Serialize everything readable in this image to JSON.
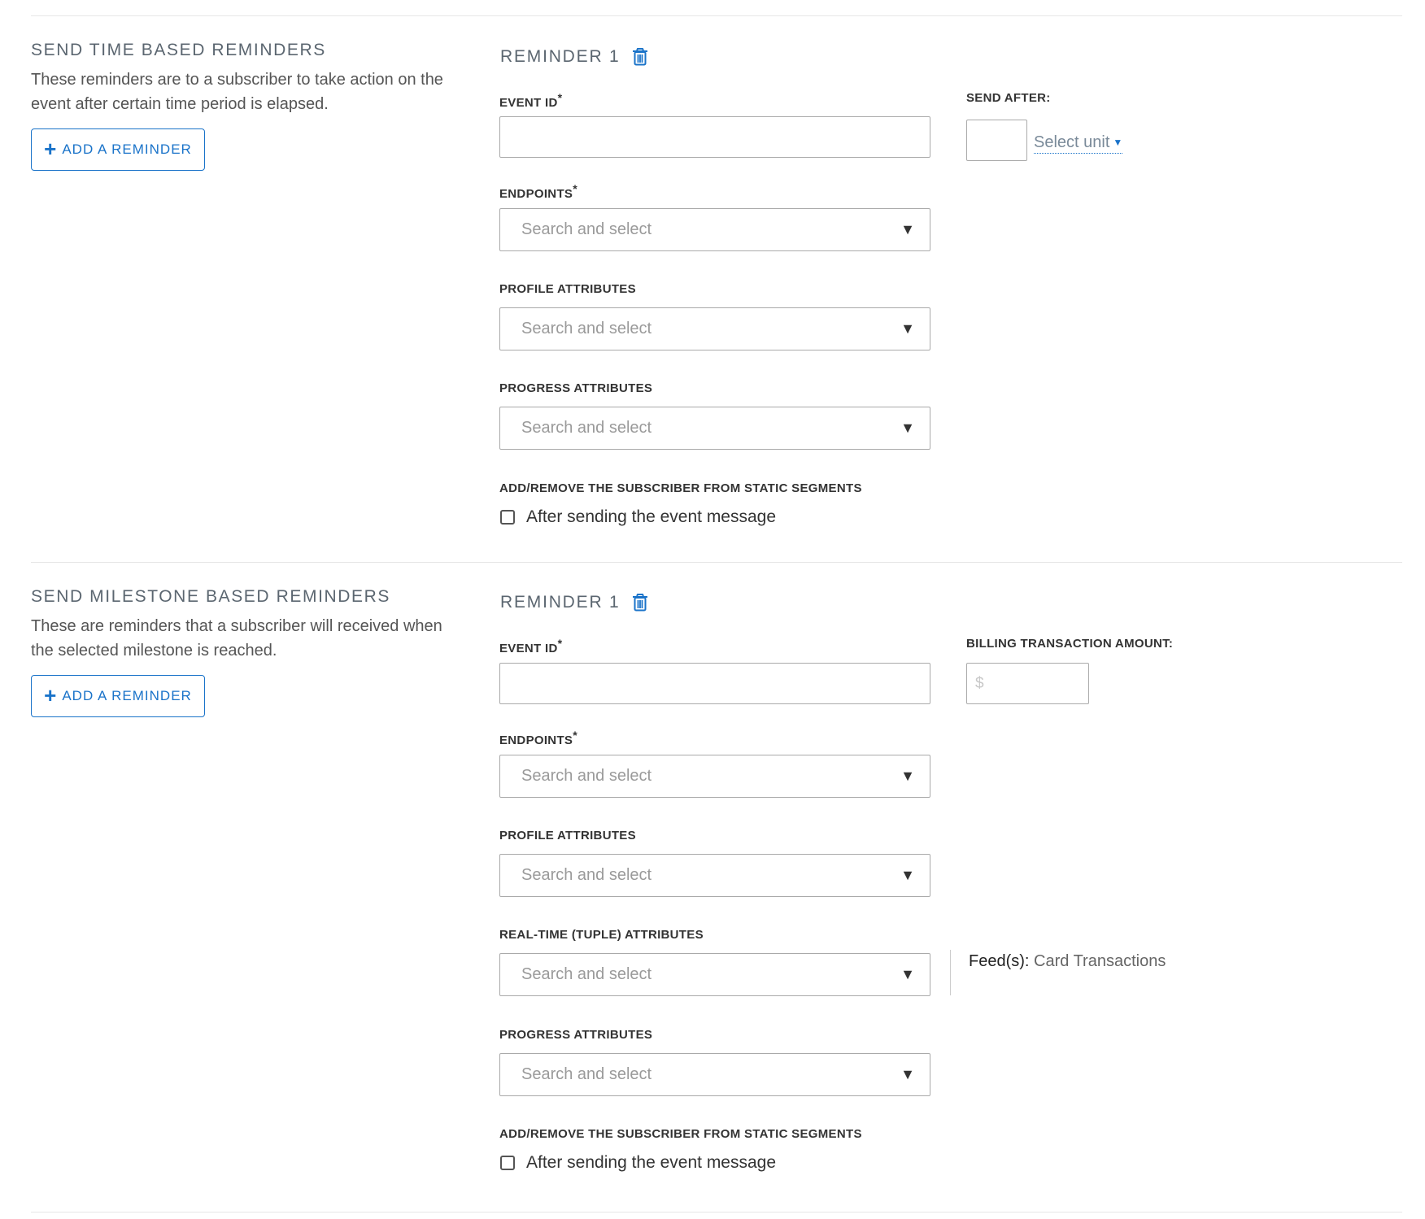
{
  "time_section": {
    "title": "SEND TIME BASED REMINDERS",
    "description": "These reminders are to a subscriber to take action on the event after certain time period is elapsed.",
    "add_button": "ADD A REMINDER",
    "reminder": {
      "title": "REMINDER 1",
      "event_id_label": "EVENT ID",
      "event_id_value": "",
      "send_after_label": "SEND AFTER:",
      "send_after_value": "",
      "unit_placeholder": "Select unit",
      "endpoints_label": "ENDPOINTS",
      "endpoints_placeholder": "Search and select",
      "profile_label": "PROFILE ATTRIBUTES",
      "profile_placeholder": "Search and select",
      "progress_label": "PROGRESS ATTRIBUTES",
      "progress_placeholder": "Search and select",
      "segments_label": "ADD/REMOVE THE SUBSCRIBER FROM STATIC SEGMENTS",
      "checkbox_label": "After sending the event message",
      "checkbox_checked": false
    }
  },
  "milestone_section": {
    "title": "SEND MILESTONE BASED REMINDERS",
    "description": "These are reminders that a subscriber will received when the selected milestone is reached.",
    "add_button": "ADD A REMINDER",
    "reminder": {
      "title": "REMINDER 1",
      "event_id_label": "EVENT ID",
      "event_id_value": "",
      "amount_label": "BILLING TRANSACTION AMOUNT:",
      "amount_placeholder": "$",
      "endpoints_label": "ENDPOINTS",
      "endpoints_placeholder": "Search and select",
      "profile_label": "PROFILE ATTRIBUTES",
      "profile_placeholder": "Search and select",
      "realtime_label": "REAL-TIME (TUPLE) ATTRIBUTES",
      "realtime_placeholder": "Search and select",
      "feeds_key": "Feed(s):",
      "feeds_value": "Card Transactions",
      "progress_label": "PROGRESS ATTRIBUTES",
      "progress_placeholder": "Search and select",
      "segments_label": "ADD/REMOVE THE SUBSCRIBER FROM STATIC SEGMENTS",
      "checkbox_label": "After sending the event message",
      "checkbox_checked": false
    }
  },
  "required_marker": "*",
  "caret_glyph": "▼",
  "unit_caret_glyph": "▼",
  "plus_glyph": "+",
  "colors": {
    "accent": "#1a73c9",
    "title": "#5b6670",
    "placeholder": "#9a9a9a",
    "border": "#aaaaaa",
    "divider": "#e6e6e6"
  }
}
